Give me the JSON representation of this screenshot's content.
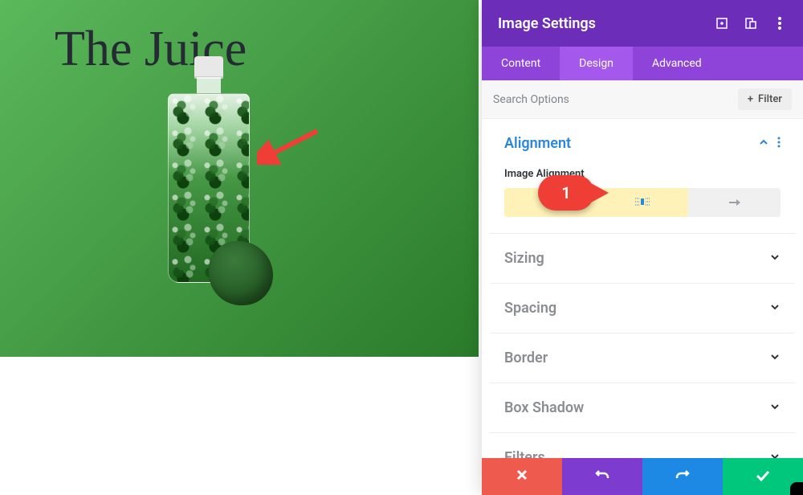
{
  "hero": {
    "title": "The Juice"
  },
  "panel": {
    "title": "Image Settings",
    "tabs": {
      "content": "Content",
      "design": "Design",
      "advanced": "Advanced",
      "active": "design"
    },
    "search_placeholder": "Search Options",
    "filter_label": "Filter"
  },
  "sections": {
    "alignment": {
      "title": "Alignment",
      "field_label": "Image Alignment",
      "options": [
        "left",
        "center",
        "right"
      ],
      "selected": "center"
    },
    "sizing": {
      "title": "Sizing"
    },
    "spacing": {
      "title": "Spacing"
    },
    "border": {
      "title": "Border"
    },
    "box_shadow": {
      "title": "Box Shadow"
    },
    "filters": {
      "title": "Filters"
    }
  },
  "callout": {
    "number": "1"
  }
}
